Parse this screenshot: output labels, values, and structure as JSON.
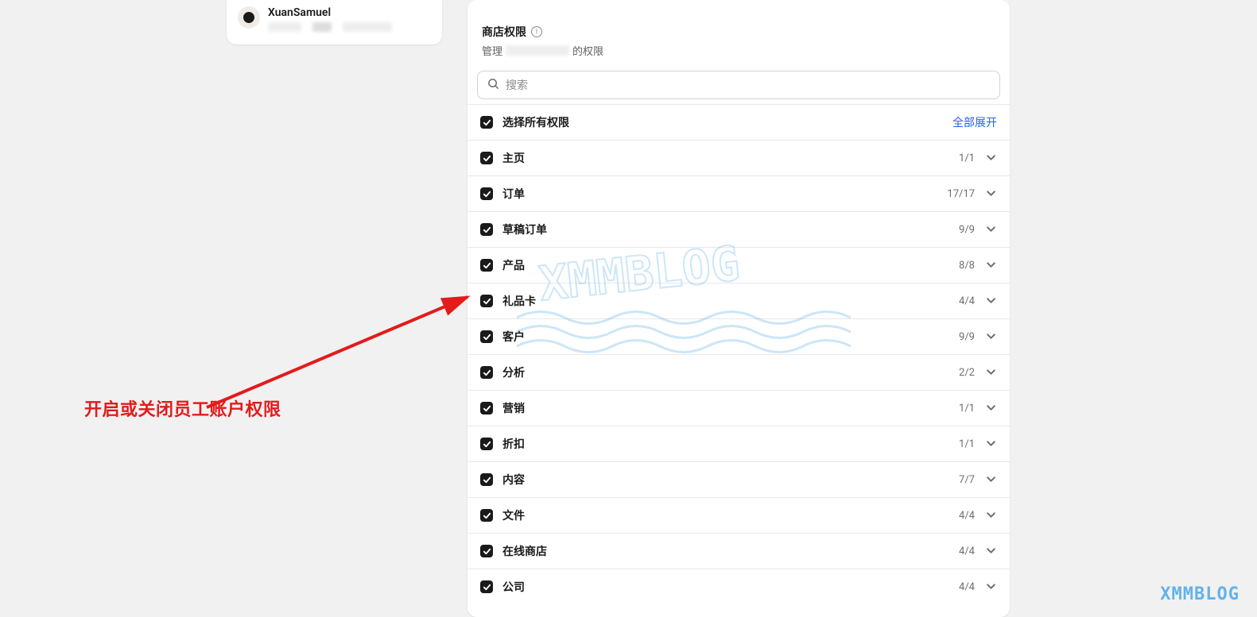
{
  "user": {
    "name": "XuanSamuel"
  },
  "panel": {
    "title": "商店权限",
    "sub_prefix": "管理",
    "sub_suffix": "的权限"
  },
  "search": {
    "placeholder": "搜索"
  },
  "select_all_label": "选择所有权限",
  "expand_all_label": "全部展开",
  "rows": [
    {
      "label": "主页",
      "count": "1/1"
    },
    {
      "label": "订单",
      "count": "17/17"
    },
    {
      "label": "草稿订单",
      "count": "9/9"
    },
    {
      "label": "产品",
      "count": "8/8"
    },
    {
      "label": "礼品卡",
      "count": "4/4"
    },
    {
      "label": "客户",
      "count": "9/9"
    },
    {
      "label": "分析",
      "count": "2/2"
    },
    {
      "label": "营销",
      "count": "1/1"
    },
    {
      "label": "折扣",
      "count": "1/1"
    },
    {
      "label": "内容",
      "count": "7/7"
    },
    {
      "label": "文件",
      "count": "4/4"
    },
    {
      "label": "在线商店",
      "count": "4/4"
    },
    {
      "label": "公司",
      "count": "4/4"
    }
  ],
  "annotation": "开启或关闭员工账户权限",
  "watermark": "XMMBLOG"
}
